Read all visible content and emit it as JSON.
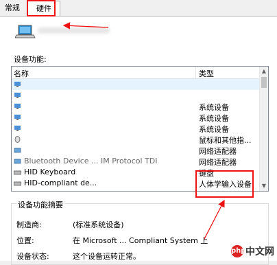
{
  "tabs": {
    "general": "常规",
    "hardware": "硬件"
  },
  "device_functions_label": "设备功能:",
  "list": {
    "col_name": "名称",
    "col_type": "类型",
    "rows": [
      {
        "name": "",
        "type": "",
        "icon": "monitor-icon"
      },
      {
        "name": "",
        "type": "",
        "icon": "monitor-icon"
      },
      {
        "name": "",
        "type": "系统设备",
        "icon": "monitor-icon"
      },
      {
        "name": "",
        "type": "系统设备",
        "icon": "monitor-icon"
      },
      {
        "name": "",
        "type": "系统设备",
        "icon": "monitor-icon"
      },
      {
        "name": "",
        "type": "鼠标和其他指...",
        "icon": "mouse-icon"
      },
      {
        "name": "",
        "type": "网络适配器",
        "icon": "network-icon"
      },
      {
        "name": "Bluetooth Device ... IM Protocol TDI",
        "type": "网络适配器",
        "icon": "network-icon"
      },
      {
        "name": "HID Keyboard",
        "type": "键盘",
        "icon": "keyboard-icon"
      },
      {
        "name": "HID-compliant de...",
        "type": "人体学输入设备",
        "icon": "keyboard-icon"
      }
    ]
  },
  "summary": {
    "title": "设备功能摘要",
    "manufacturer_label": "制造商:",
    "manufacturer_value": "(标准系统设备)",
    "location_label": "位置:",
    "location_value": "在 Microsoft ... Compliant System 上",
    "status_label": "设备状态:",
    "status_value": "这个设备运转正常。"
  },
  "watermark": {
    "logo": "php",
    "text": "中文网"
  },
  "colors": {
    "annotation_red": "#e11",
    "selection": "#cce8ff"
  }
}
